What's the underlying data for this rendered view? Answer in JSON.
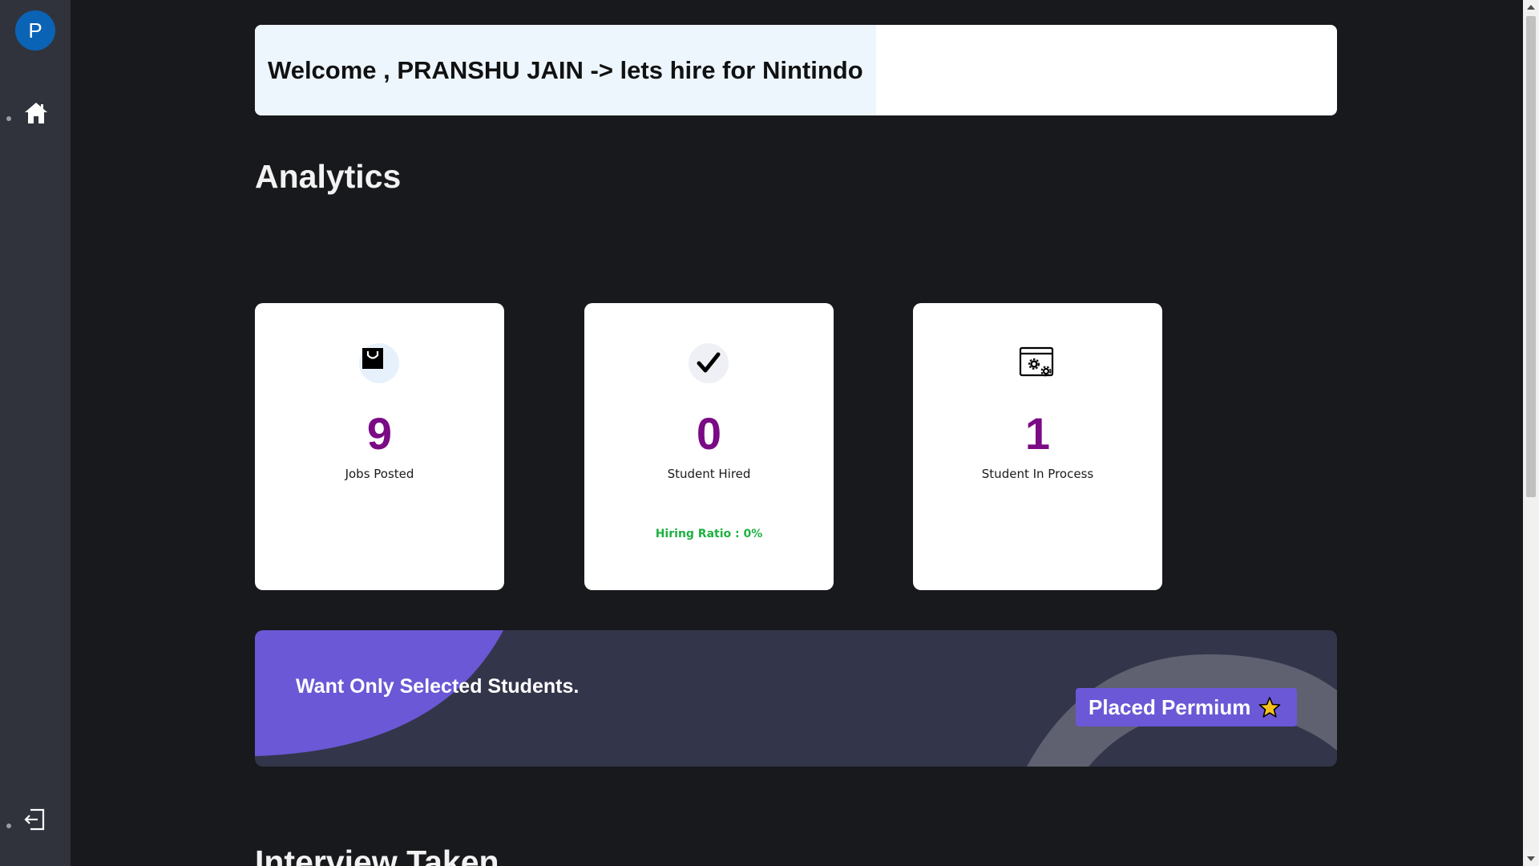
{
  "sidebar": {
    "avatar_initial": "P",
    "items": [
      {
        "icon": "home-icon"
      },
      {
        "icon": "logout-icon"
      }
    ]
  },
  "welcome": {
    "text": "Welcome , PRANSHU JAIN -> lets hire for Nintindo"
  },
  "analytics": {
    "title": "Analytics",
    "cards": [
      {
        "icon": "shopping-bag-icon",
        "value": "9",
        "label": "Jobs Posted",
        "note": ""
      },
      {
        "icon": "checkmark-icon",
        "value": "0",
        "label": "Student Hired",
        "note": "Hiring Ratio : 0%"
      },
      {
        "icon": "settings-window-icon",
        "value": "1",
        "label": "Student In Process",
        "note": ""
      }
    ]
  },
  "banner": {
    "text": "Want Only Selected Students.",
    "button_label": "Placed Permium"
  },
  "next_section": {
    "title": "Interview Taken"
  },
  "colors": {
    "background": "#18191c",
    "sidebar": "#30333b",
    "accent_purple": "#6a58d6",
    "value_purple": "#7b0a85",
    "success_green": "#1fb141"
  }
}
